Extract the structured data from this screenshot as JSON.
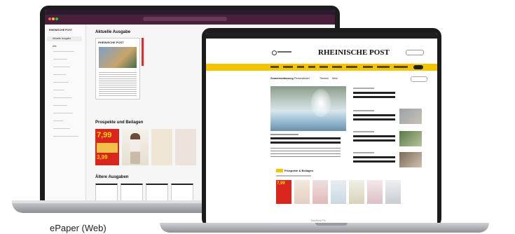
{
  "caption": "ePaper (Web)",
  "back_laptop": {
    "brand_logo": "RHEINISCHE POST",
    "section_current": "Aktuelle Ausgabe",
    "section_supplements": "Prospekte und Beilagen",
    "section_older": "Ältere Ausgaben",
    "sidebar_items": [
      "Aktuelle Ausgabe",
      "Alle",
      "",
      "",
      "",
      "",
      "",
      "",
      "",
      "",
      "",
      "",
      "",
      ""
    ],
    "paper_masthead": "RHEINISCHE POST",
    "promo_price": "7,99",
    "promo_price_2": "3,99"
  },
  "front_laptop": {
    "masthead": "RHEINISCHE POST",
    "nav_items": [
      "",
      "",
      "",
      "",
      "",
      "",
      "",
      "",
      "",
      ""
    ],
    "tabs": [
      "Zusammenfassung",
      "Personalisiert",
      "Themen",
      "Mehr"
    ],
    "hero_headline": "",
    "story_headlines": [
      "",
      "",
      "",
      ""
    ],
    "epaper_section": "Prospekte & Beilagen",
    "base_label": "MacBook Pro",
    "promo_price": "7,99"
  },
  "colors": {
    "brand_yellow": "#f5c400",
    "dark_bezel": "#1c1c1e",
    "promo_red": "#d9251c"
  }
}
